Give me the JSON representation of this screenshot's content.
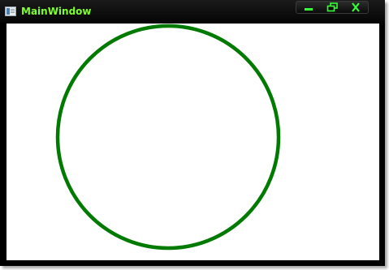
{
  "window": {
    "title": "MainWindow",
    "title_color": "#7fff2a",
    "icon": "app-window-icon"
  },
  "caption_buttons": [
    {
      "name": "minimize-button",
      "icon": "minimize-icon",
      "color": "#33ff33"
    },
    {
      "name": "maximize-button",
      "icon": "restore-icon",
      "color": "#33ff33"
    },
    {
      "name": "close-button",
      "icon": "close-icon",
      "color": "#33ff33"
    }
  ],
  "canvas": {
    "shape": "circle",
    "stroke_color": "#007a00",
    "fill": "none"
  }
}
